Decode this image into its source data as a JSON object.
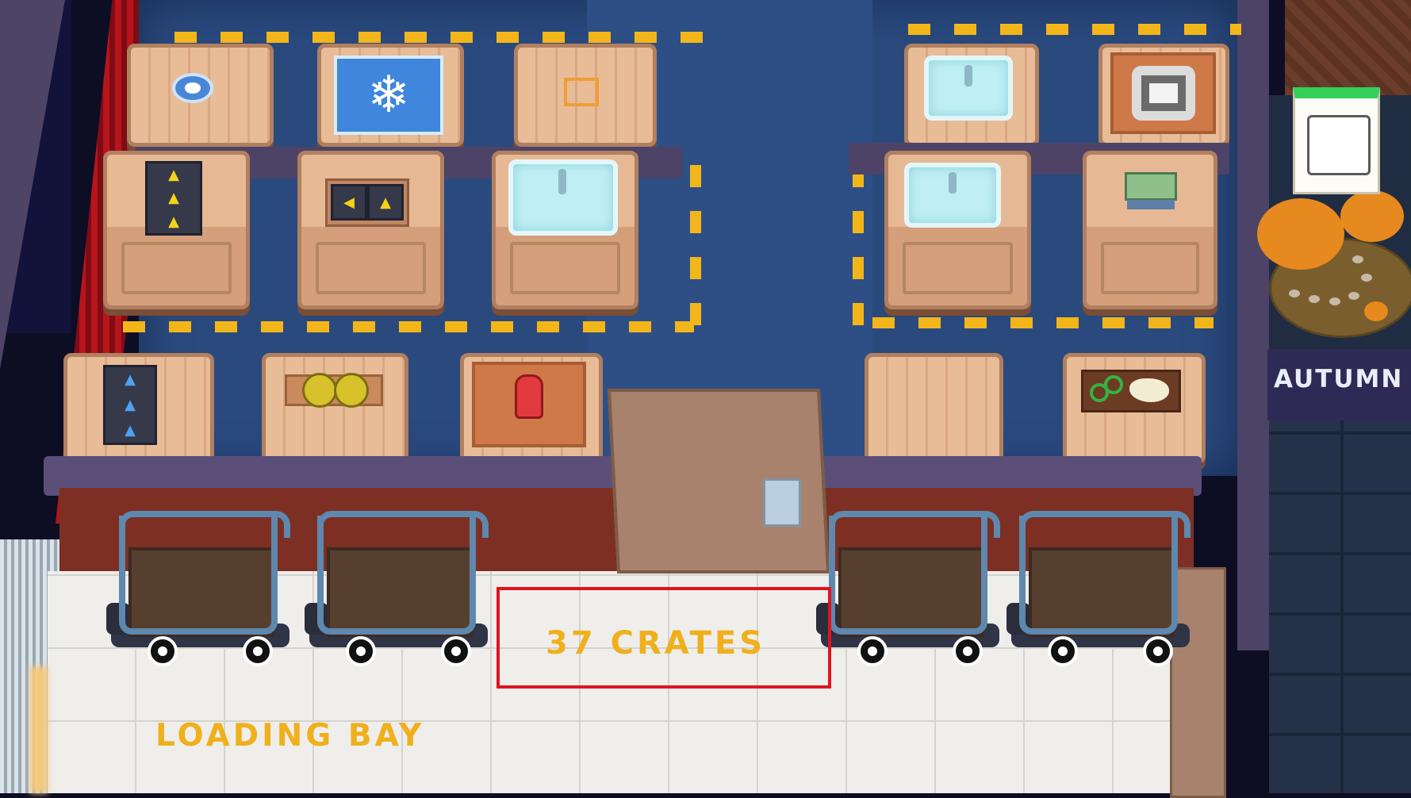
{
  "scene": {
    "title": "Loading Bay",
    "floor_label": "LOADING BAY",
    "crate_counter": "37 CRATES",
    "sign_label": "AUTUMN",
    "highlight_color": "#e0141e",
    "label_color": "#f0b01c"
  },
  "stations": [
    {
      "name": "mixing-ring",
      "icon": "ring-icon"
    },
    {
      "name": "freezer",
      "icon": "snowflake-icon"
    },
    {
      "name": "empty-counter",
      "icon": "frame-icon"
    },
    {
      "name": "sink",
      "icon": "sink-icon"
    },
    {
      "name": "stove",
      "icon": "stove-icon"
    },
    {
      "name": "conveyor-yellow",
      "icon": "conveyor-icon"
    },
    {
      "name": "mixer",
      "icon": "mixer-icon"
    },
    {
      "name": "conveyor-blue",
      "icon": "conveyor-icon"
    },
    {
      "name": "pans",
      "icon": "pan-icon"
    },
    {
      "name": "ketchup",
      "icon": "bottle-icon"
    },
    {
      "name": "plain-crate",
      "icon": "crate-icon"
    },
    {
      "name": "toppings-tray",
      "icon": "tray-icon"
    },
    {
      "name": "recipe-book",
      "icon": "book-icon"
    }
  ],
  "hud": {
    "map_icon": "map-icon"
  },
  "carts_count": 4
}
